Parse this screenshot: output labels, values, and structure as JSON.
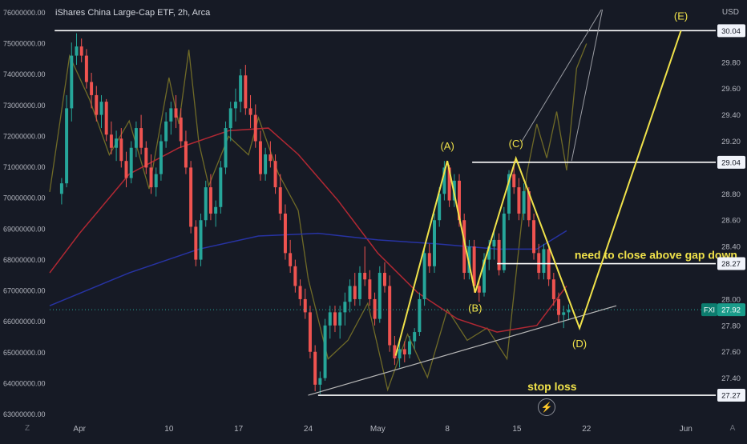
{
  "header": {
    "symbol_title": "iShares China Large-Cap ETF, 2h, Arca",
    "currency": "USD"
  },
  "chart_data": {
    "type": "candlestick",
    "title": "iShares China Large-Cap ETF, 2h, Arca",
    "ticker": "FXI",
    "last_price": "27.92",
    "y_right": {
      "unit": "USD",
      "range": [
        27.1,
        30.2
      ],
      "ticks": [
        "30.04",
        "29.80",
        "29.60",
        "29.40",
        "29.20",
        "29.04",
        "28.80",
        "28.60",
        "28.40",
        "28.27",
        "28.00",
        "27.80",
        "27.60",
        "27.40",
        "27.27"
      ],
      "tick_values": [
        30.04,
        29.8,
        29.6,
        29.4,
        29.2,
        29.04,
        28.8,
        28.6,
        28.4,
        28.27,
        28.0,
        27.8,
        27.6,
        27.4,
        27.27
      ]
    },
    "y_left": {
      "range": [
        62900000,
        76100000
      ],
      "ticks": [
        "76000000.00",
        "75000000.00",
        "74000000.00",
        "73000000.00",
        "72000000.00",
        "71000000.00",
        "70000000.00",
        "69000000.00",
        "68000000.00",
        "67000000.00",
        "66000000.00",
        "65000000.00",
        "64000000.00",
        "63000000.00"
      ],
      "tick_values": [
        76000000,
        75000000,
        74000000,
        73000000,
        72000000,
        71000000,
        70000000,
        69000000,
        68000000,
        67000000,
        66000000,
        65000000,
        64000000,
        63000000
      ]
    },
    "x_axis": {
      "domain_days": [
        -3,
        64
      ],
      "ticks": [
        {
          "label": "Apr",
          "day": 0
        },
        {
          "label": "10",
          "day": 9
        },
        {
          "label": "17",
          "day": 16
        },
        {
          "label": "24",
          "day": 23
        },
        {
          "label": "May",
          "day": 30
        },
        {
          "label": "8",
          "day": 37
        },
        {
          "label": "15",
          "day": 44
        },
        {
          "label": "22",
          "day": 51
        },
        {
          "label": "Jun",
          "day": 61
        }
      ]
    },
    "candles": [
      {
        "d": -1.8,
        "o": 28.8,
        "h": 28.92,
        "l": 28.72,
        "c": 28.88
      },
      {
        "d": -1.3,
        "o": 28.88,
        "h": 29.55,
        "l": 28.85,
        "c": 29.45
      },
      {
        "d": -0.8,
        "o": 29.45,
        "h": 29.95,
        "l": 29.35,
        "c": 29.85
      },
      {
        "d": -0.3,
        "o": 29.85,
        "h": 30.02,
        "l": 29.78,
        "c": 29.92
      },
      {
        "d": 0.2,
        "o": 29.92,
        "h": 29.98,
        "l": 29.8,
        "c": 29.85
      },
      {
        "d": 0.7,
        "o": 29.85,
        "h": 29.9,
        "l": 29.6,
        "c": 29.65
      },
      {
        "d": 1.2,
        "o": 29.65,
        "h": 29.72,
        "l": 29.45,
        "c": 29.55
      },
      {
        "d": 1.7,
        "o": 29.55,
        "h": 29.62,
        "l": 29.35,
        "c": 29.4
      },
      {
        "d": 2.2,
        "o": 29.4,
        "h": 29.55,
        "l": 29.3,
        "c": 29.5
      },
      {
        "d": 2.7,
        "o": 29.5,
        "h": 29.52,
        "l": 29.2,
        "c": 29.25
      },
      {
        "d": 3.2,
        "o": 29.25,
        "h": 29.35,
        "l": 29.1,
        "c": 29.15
      },
      {
        "d": 3.7,
        "o": 29.15,
        "h": 29.28,
        "l": 29.05,
        "c": 29.22
      },
      {
        "d": 4.2,
        "o": 29.22,
        "h": 29.3,
        "l": 29.0,
        "c": 29.05
      },
      {
        "d": 4.7,
        "o": 29.05,
        "h": 29.12,
        "l": 28.85,
        "c": 28.92
      },
      {
        "d": 5.2,
        "o": 28.92,
        "h": 29.2,
        "l": 28.88,
        "c": 29.15
      },
      {
        "d": 5.7,
        "o": 29.15,
        "h": 29.35,
        "l": 29.08,
        "c": 29.3
      },
      {
        "d": 6.2,
        "o": 29.3,
        "h": 29.4,
        "l": 29.1,
        "c": 29.15
      },
      {
        "d": 6.7,
        "o": 29.15,
        "h": 29.2,
        "l": 28.95,
        "c": 29.0
      },
      {
        "d": 7.2,
        "o": 29.0,
        "h": 29.1,
        "l": 28.8,
        "c": 28.85
      },
      {
        "d": 7.7,
        "o": 28.85,
        "h": 29.0,
        "l": 28.78,
        "c": 28.95
      },
      {
        "d": 8.2,
        "o": 28.95,
        "h": 29.25,
        "l": 28.9,
        "c": 29.2
      },
      {
        "d": 8.7,
        "o": 29.2,
        "h": 29.42,
        "l": 29.15,
        "c": 29.35
      },
      {
        "d": 9.2,
        "o": 29.35,
        "h": 29.5,
        "l": 29.25,
        "c": 29.45
      },
      {
        "d": 9.7,
        "o": 29.45,
        "h": 29.55,
        "l": 29.3,
        "c": 29.38
      },
      {
        "d": 10.2,
        "o": 29.38,
        "h": 29.45,
        "l": 29.15,
        "c": 29.2
      },
      {
        "d": 10.7,
        "o": 29.2,
        "h": 29.28,
        "l": 28.95,
        "c": 29.0
      },
      {
        "d": 11.2,
        "o": 29.0,
        "h": 29.05,
        "l": 28.5,
        "c": 28.55
      },
      {
        "d": 11.7,
        "o": 28.55,
        "h": 28.6,
        "l": 28.25,
        "c": 28.3
      },
      {
        "d": 12.2,
        "o": 28.3,
        "h": 28.65,
        "l": 28.25,
        "c": 28.6
      },
      {
        "d": 12.7,
        "o": 28.6,
        "h": 28.9,
        "l": 28.55,
        "c": 28.85
      },
      {
        "d": 13.2,
        "o": 28.85,
        "h": 28.95,
        "l": 28.6,
        "c": 28.65
      },
      {
        "d": 13.7,
        "o": 28.65,
        "h": 28.75,
        "l": 28.55,
        "c": 28.7
      },
      {
        "d": 14.2,
        "o": 28.7,
        "h": 29.05,
        "l": 28.65,
        "c": 29.0
      },
      {
        "d": 14.7,
        "o": 29.0,
        "h": 29.35,
        "l": 28.95,
        "c": 29.3
      },
      {
        "d": 15.2,
        "o": 29.3,
        "h": 29.5,
        "l": 29.2,
        "c": 29.45
      },
      {
        "d": 15.7,
        "o": 29.45,
        "h": 29.6,
        "l": 29.35,
        "c": 29.5
      },
      {
        "d": 16.2,
        "o": 29.5,
        "h": 29.75,
        "l": 29.42,
        "c": 29.7
      },
      {
        "d": 16.7,
        "o": 29.7,
        "h": 29.78,
        "l": 29.4,
        "c": 29.45
      },
      {
        "d": 17.2,
        "o": 29.45,
        "h": 29.55,
        "l": 29.3,
        "c": 29.4
      },
      {
        "d": 17.7,
        "o": 29.4,
        "h": 29.48,
        "l": 29.15,
        "c": 29.2
      },
      {
        "d": 18.2,
        "o": 29.2,
        "h": 29.28,
        "l": 28.9,
        "c": 28.95
      },
      {
        "d": 18.7,
        "o": 28.95,
        "h": 29.15,
        "l": 28.9,
        "c": 29.1
      },
      {
        "d": 19.2,
        "o": 29.1,
        "h": 29.2,
        "l": 29.0,
        "c": 29.05
      },
      {
        "d": 19.7,
        "o": 29.05,
        "h": 29.1,
        "l": 28.8,
        "c": 28.85
      },
      {
        "d": 20.2,
        "o": 28.85,
        "h": 28.95,
        "l": 28.6,
        "c": 28.65
      },
      {
        "d": 20.7,
        "o": 28.65,
        "h": 28.72,
        "l": 28.3,
        "c": 28.35
      },
      {
        "d": 21.2,
        "o": 28.35,
        "h": 28.45,
        "l": 28.2,
        "c": 28.25
      },
      {
        "d": 21.7,
        "o": 28.25,
        "h": 28.3,
        "l": 28.05,
        "c": 28.1
      },
      {
        "d": 22.2,
        "o": 28.1,
        "h": 28.15,
        "l": 27.95,
        "c": 28.0
      },
      {
        "d": 22.7,
        "o": 28.0,
        "h": 28.08,
        "l": 27.85,
        "c": 27.9
      },
      {
        "d": 23.2,
        "o": 27.9,
        "h": 27.95,
        "l": 27.55,
        "c": 27.6
      },
      {
        "d": 23.7,
        "o": 27.6,
        "h": 27.65,
        "l": 27.3,
        "c": 27.35
      },
      {
        "d": 24.2,
        "o": 27.35,
        "h": 27.45,
        "l": 27.28,
        "c": 27.4
      },
      {
        "d": 24.7,
        "o": 27.4,
        "h": 27.85,
        "l": 27.38,
        "c": 27.8
      },
      {
        "d": 25.2,
        "o": 27.8,
        "h": 27.95,
        "l": 27.7,
        "c": 27.9
      },
      {
        "d": 25.7,
        "o": 27.9,
        "h": 27.95,
        "l": 27.75,
        "c": 27.8
      },
      {
        "d": 26.2,
        "o": 27.8,
        "h": 27.95,
        "l": 27.7,
        "c": 27.9
      },
      {
        "d": 26.7,
        "o": 27.9,
        "h": 28.05,
        "l": 27.8,
        "c": 27.98
      },
      {
        "d": 27.2,
        "o": 27.98,
        "h": 28.15,
        "l": 27.9,
        "c": 28.1
      },
      {
        "d": 27.7,
        "o": 28.1,
        "h": 28.2,
        "l": 27.95,
        "c": 28.0
      },
      {
        "d": 28.2,
        "o": 28.0,
        "h": 28.25,
        "l": 27.95,
        "c": 28.2
      },
      {
        "d": 28.7,
        "o": 28.2,
        "h": 28.4,
        "l": 28.1,
        "c": 28.15
      },
      {
        "d": 29.2,
        "o": 28.15,
        "h": 28.22,
        "l": 27.95,
        "c": 28.0
      },
      {
        "d": 29.7,
        "o": 28.0,
        "h": 28.05,
        "l": 27.8,
        "c": 27.85
      },
      {
        "d": 30.2,
        "o": 27.85,
        "h": 28.25,
        "l": 27.82,
        "c": 28.2
      },
      {
        "d": 30.7,
        "o": 28.2,
        "h": 28.28,
        "l": 28.05,
        "c": 28.1
      },
      {
        "d": 31.2,
        "o": 28.1,
        "h": 28.18,
        "l": 27.6,
        "c": 27.65
      },
      {
        "d": 31.7,
        "o": 27.65,
        "h": 27.72,
        "l": 27.5,
        "c": 27.55
      },
      {
        "d": 32.2,
        "o": 27.55,
        "h": 27.68,
        "l": 27.48,
        "c": 27.62
      },
      {
        "d": 32.7,
        "o": 27.62,
        "h": 27.68,
        "l": 27.52,
        "c": 27.58
      },
      {
        "d": 33.2,
        "o": 27.58,
        "h": 27.72,
        "l": 27.55,
        "c": 27.68
      },
      {
        "d": 33.7,
        "o": 27.68,
        "h": 27.78,
        "l": 27.62,
        "c": 27.75
      },
      {
        "d": 34.2,
        "o": 27.75,
        "h": 28.05,
        "l": 27.72,
        "c": 28.0
      },
      {
        "d": 34.7,
        "o": 28.0,
        "h": 28.38,
        "l": 27.95,
        "c": 28.35
      },
      {
        "d": 35.2,
        "o": 28.35,
        "h": 28.42,
        "l": 28.2,
        "c": 28.25
      },
      {
        "d": 35.7,
        "o": 28.25,
        "h": 28.65,
        "l": 28.2,
        "c": 28.6
      },
      {
        "d": 36.2,
        "o": 28.6,
        "h": 28.85,
        "l": 28.55,
        "c": 28.8
      },
      {
        "d": 36.7,
        "o": 28.8,
        "h": 29.05,
        "l": 28.75,
        "c": 29.0
      },
      {
        "d": 37.2,
        "o": 29.0,
        "h": 29.02,
        "l": 28.7,
        "c": 28.75
      },
      {
        "d": 37.7,
        "o": 28.75,
        "h": 28.95,
        "l": 28.7,
        "c": 28.9
      },
      {
        "d": 38.2,
        "o": 28.9,
        "h": 28.95,
        "l": 28.55,
        "c": 28.6
      },
      {
        "d": 38.7,
        "o": 28.6,
        "h": 28.65,
        "l": 28.15,
        "c": 28.2
      },
      {
        "d": 39.2,
        "o": 28.2,
        "h": 28.45,
        "l": 28.15,
        "c": 28.4
      },
      {
        "d": 39.7,
        "o": 28.4,
        "h": 28.45,
        "l": 28.05,
        "c": 28.1
      },
      {
        "d": 40.2,
        "o": 28.1,
        "h": 28.15,
        "l": 27.98,
        "c": 28.05
      },
      {
        "d": 40.7,
        "o": 28.05,
        "h": 28.35,
        "l": 28.02,
        "c": 28.3
      },
      {
        "d": 41.2,
        "o": 28.3,
        "h": 28.45,
        "l": 28.22,
        "c": 28.4
      },
      {
        "d": 41.7,
        "o": 28.4,
        "h": 28.52,
        "l": 28.3,
        "c": 28.45
      },
      {
        "d": 42.2,
        "o": 28.45,
        "h": 28.5,
        "l": 28.18,
        "c": 28.22
      },
      {
        "d": 42.7,
        "o": 28.22,
        "h": 28.7,
        "l": 28.2,
        "c": 28.65
      },
      {
        "d": 43.2,
        "o": 28.65,
        "h": 28.98,
        "l": 28.6,
        "c": 28.95
      },
      {
        "d": 43.7,
        "o": 28.95,
        "h": 29.05,
        "l": 28.8,
        "c": 28.85
      },
      {
        "d": 44.2,
        "o": 28.85,
        "h": 28.92,
        "l": 28.6,
        "c": 28.65
      },
      {
        "d": 44.7,
        "o": 28.65,
        "h": 28.88,
        "l": 28.6,
        "c": 28.82
      },
      {
        "d": 45.2,
        "o": 28.82,
        "h": 28.85,
        "l": 28.55,
        "c": 28.6
      },
      {
        "d": 45.7,
        "o": 28.6,
        "h": 28.65,
        "l": 28.3,
        "c": 28.35
      },
      {
        "d": 46.2,
        "o": 28.35,
        "h": 28.42,
        "l": 28.15,
        "c": 28.2
      },
      {
        "d": 46.7,
        "o": 28.2,
        "h": 28.42,
        "l": 28.15,
        "c": 28.38
      },
      {
        "d": 47.2,
        "o": 28.38,
        "h": 28.42,
        "l": 28.1,
        "c": 28.15
      },
      {
        "d": 47.7,
        "o": 28.15,
        "h": 28.2,
        "l": 27.95,
        "c": 28.0
      },
      {
        "d": 48.2,
        "o": 28.0,
        "h": 28.05,
        "l": 27.82,
        "c": 27.88
      },
      {
        "d": 48.7,
        "o": 27.88,
        "h": 27.95,
        "l": 27.78,
        "c": 27.9
      },
      {
        "d": 49.2,
        "o": 27.9,
        "h": 27.96,
        "l": 27.84,
        "c": 27.92
      }
    ],
    "ma_red": {
      "name": "",
      "color": "#b22833",
      "points": [
        [
          -3,
          28.2
        ],
        [
          0,
          28.5
        ],
        [
          5,
          28.95
        ],
        [
          10,
          29.15
        ],
        [
          15,
          29.28
        ],
        [
          19,
          29.3
        ],
        [
          22,
          29.1
        ],
        [
          26,
          28.75
        ],
        [
          30,
          28.35
        ],
        [
          34,
          28.05
        ],
        [
          38,
          27.85
        ],
        [
          42,
          27.75
        ],
        [
          46,
          27.8
        ],
        [
          49,
          28.1
        ]
      ]
    },
    "ma_blue": {
      "name": "",
      "color": "#2733a3",
      "points": [
        [
          -3,
          27.95
        ],
        [
          5,
          28.2
        ],
        [
          12,
          28.38
        ],
        [
          18,
          28.48
        ],
        [
          24,
          28.5
        ],
        [
          30,
          28.45
        ],
        [
          36,
          28.42
        ],
        [
          42,
          28.38
        ],
        [
          46,
          28.38
        ],
        [
          49,
          28.52
        ]
      ]
    },
    "volume_line": {
      "name": "",
      "color": "#6f6a27",
      "points": [
        [
          -3,
          70200000
        ],
        [
          -1,
          74600000
        ],
        [
          1,
          73200000
        ],
        [
          3,
          71400000
        ],
        [
          5,
          72500000
        ],
        [
          7,
          70300000
        ],
        [
          9,
          73900000
        ],
        [
          10,
          72400000
        ],
        [
          11,
          74800000
        ],
        [
          12,
          71800000
        ],
        [
          13,
          70400000
        ],
        [
          15,
          72000000
        ],
        [
          17,
          71400000
        ],
        [
          18,
          72600000
        ],
        [
          20,
          70800000
        ],
        [
          22,
          69600000
        ],
        [
          23,
          67400000
        ],
        [
          25,
          64800000
        ],
        [
          27,
          65400000
        ],
        [
          29,
          66600000
        ],
        [
          31,
          63800000
        ],
        [
          33,
          65600000
        ],
        [
          35,
          64200000
        ],
        [
          37,
          66400000
        ],
        [
          39,
          65400000
        ],
        [
          41,
          65800000
        ],
        [
          43,
          64800000
        ],
        [
          44,
          67800000
        ],
        [
          45,
          70800000
        ],
        [
          46,
          72400000
        ],
        [
          47,
          71300000
        ],
        [
          48,
          72800000
        ],
        [
          49,
          70900000
        ],
        [
          50,
          74200000
        ],
        [
          51,
          75000000
        ]
      ]
    },
    "horizontal_levels": [
      {
        "value": 30.04,
        "label": "30.04",
        "d_start": -2.5,
        "d_end": 64
      },
      {
        "value": 29.04,
        "label": "29.04",
        "d_start": 39.5,
        "d_end": 64
      },
      {
        "value": 28.27,
        "label": "28.27",
        "d_start": 42,
        "d_end": 64
      },
      {
        "value": 27.27,
        "label": "27.27",
        "d_start": 24,
        "d_end": 64
      }
    ],
    "trendline": {
      "from": {
        "d": 23,
        "v": 27.27
      },
      "to": {
        "d": 54,
        "v": 27.95
      }
    },
    "wave_path": [
      {
        "label": "",
        "d": 31.8,
        "v": 27.57
      },
      {
        "label": "(A)",
        "d": 37.0,
        "v": 29.05
      },
      {
        "label": "(B)",
        "d": 39.8,
        "v": 28.05
      },
      {
        "label": "(C)",
        "d": 43.9,
        "v": 29.07
      },
      {
        "label": "(D)",
        "d": 50.3,
        "v": 27.78
      },
      {
        "label": "(E)",
        "d": 60.5,
        "v": 30.04
      }
    ],
    "channel_upper": {
      "from": {
        "d": 44.5,
        "v": 29.2
      },
      "to": {
        "d": 52.5,
        "v": 30.2
      }
    },
    "channel_lower": {
      "from": {
        "d": 49.5,
        "v": 29.05
      },
      "to": {
        "d": 52.6,
        "v": 30.2
      }
    },
    "annotations": [
      {
        "text": "need to close above gap down",
        "d": 49.8,
        "v": 28.27
      },
      {
        "text": "stop loss",
        "d": 47.0,
        "v": 27.27
      }
    ],
    "last_price_line": 27.92,
    "grid": false,
    "colors": {
      "background": "#161a25",
      "up": "#26a69a",
      "down": "#ef5350",
      "wave": "#f0e24a",
      "level": "#ffffff",
      "trendline": "#b8b8b8",
      "axis_text": "#b2b5be"
    }
  }
}
